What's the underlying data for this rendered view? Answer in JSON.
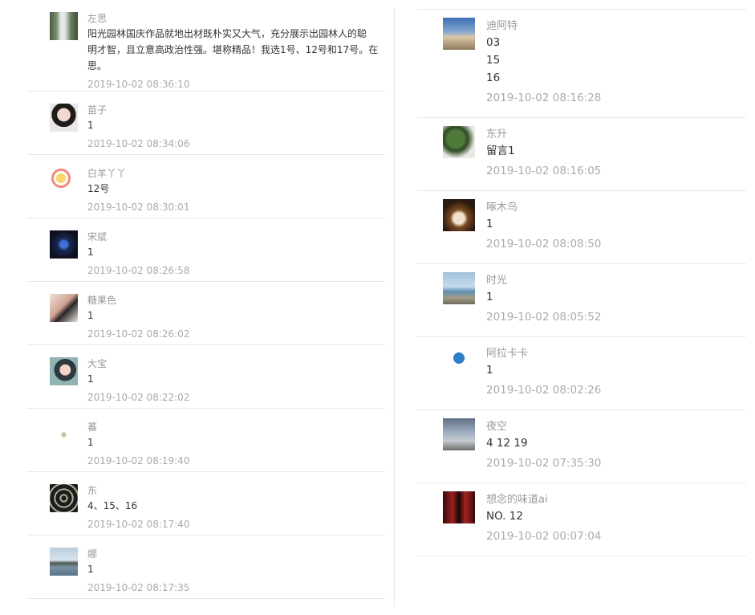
{
  "left_comments": [
    {
      "name": "左思",
      "lines": [
        "阳光园林国庆作品就地出材既朴实又大气，充分展示出园林人的聪",
        "明才智，且立意高政治性强。堪称精品！我选1号、12号和17号。在",
        "思。"
      ],
      "time": "2019-10-02 08:36:10",
      "avatar": "waterfall-photo-avatar"
    },
    {
      "name": "苗子",
      "lines": [
        "1"
      ],
      "time": "2019-10-02 08:34:06",
      "avatar": "girl-glasses-avatar"
    },
    {
      "name": "白羊丫丫",
      "lines": [
        "12号"
      ],
      "time": "2019-10-02 08:30:01",
      "avatar": "cartoon-character-avatar"
    },
    {
      "name": "宋斌",
      "lines": [
        "1"
      ],
      "time": "2019-10-02 08:26:58",
      "avatar": "night-figure-avatar"
    },
    {
      "name": "糖果色",
      "lines": [
        "1"
      ],
      "time": "2019-10-02 08:26:02",
      "avatar": "selfie-avatar"
    },
    {
      "name": "大宝",
      "lines": [
        "1"
      ],
      "time": "2019-10-02 08:22:02",
      "avatar": "girl-portrait-avatar"
    },
    {
      "name": "蕃",
      "lines": [
        "1"
      ],
      "time": "2019-10-02 08:19:40",
      "avatar": "small-logo-avatar"
    },
    {
      "name": "东",
      "lines": [
        "4、15、16"
      ],
      "time": "2019-10-02 08:17:40",
      "avatar": "mosaic-avatar"
    },
    {
      "name": "娜",
      "lines": [
        "1"
      ],
      "time": "2019-10-02 08:17:35",
      "avatar": "lake-landscape-avatar"
    }
  ],
  "right_comments": [
    {
      "name": "迪阿特",
      "lines": [
        "03",
        "15",
        "16"
      ],
      "time": "2019-10-02 08:16:28",
      "avatar": "runner-sunset-avatar"
    },
    {
      "name": "东升",
      "lines": [
        "留言1"
      ],
      "time": "2019-10-02 08:16:05",
      "avatar": "plant-photo-avatar"
    },
    {
      "name": "啄木鸟",
      "lines": [
        "1"
      ],
      "time": "2019-10-02 08:08:50",
      "avatar": "food-photo-avatar"
    },
    {
      "name": "时光",
      "lines": [
        "1"
      ],
      "time": "2019-10-02 08:05:52",
      "avatar": "seaside-avatar"
    },
    {
      "name": "阿拉卡卡",
      "lines": [
        "1"
      ],
      "time": "2019-10-02 08:02:26",
      "avatar": "company-logo-avatar"
    },
    {
      "name": "夜空",
      "lines": [
        "4 12 19"
      ],
      "time": "2019-10-02 07:35:30",
      "avatar": "eiffel-tower-avatar"
    },
    {
      "name": "想念的味道ai",
      "lines": [
        "NO. 12"
      ],
      "time": "2019-10-02 00:07:04",
      "avatar": "red-dress-avatar"
    }
  ],
  "colors": {
    "name": "#999999",
    "content": "#333333",
    "time": "#aaaaaa",
    "divider": "#e7e7e7"
  }
}
